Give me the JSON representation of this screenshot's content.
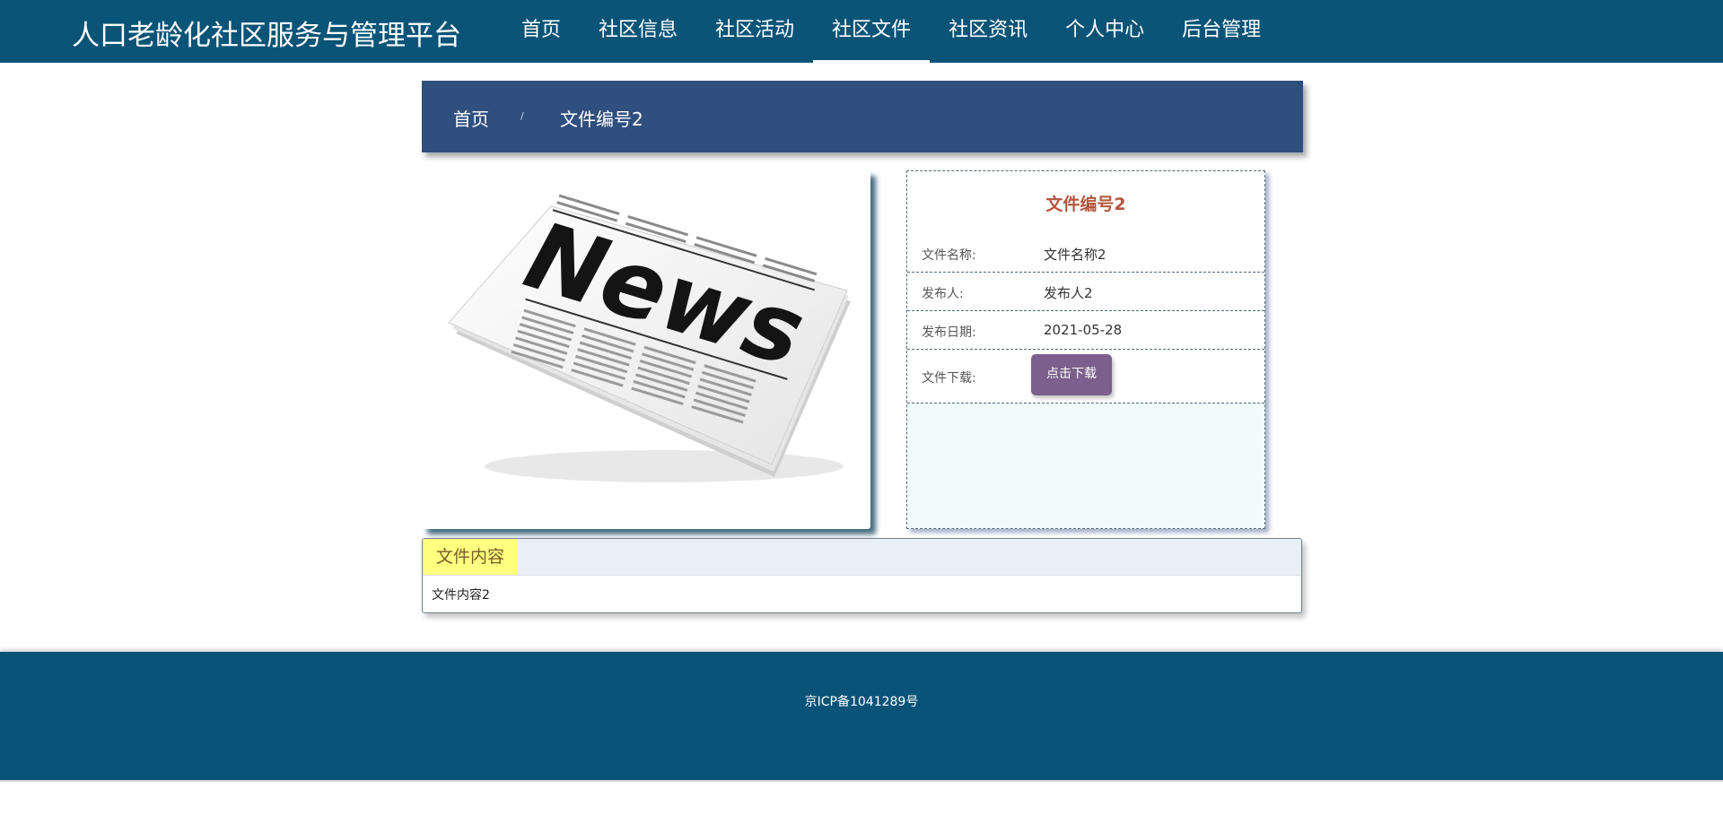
{
  "header": {
    "site_title": "人口老龄化社区服务与管理平台",
    "nav": [
      {
        "label": "首页"
      },
      {
        "label": "社区信息"
      },
      {
        "label": "社区活动"
      },
      {
        "label": "社区文件",
        "active": true
      },
      {
        "label": "社区资讯"
      },
      {
        "label": "个人中心"
      },
      {
        "label": "后台管理"
      }
    ]
  },
  "breadcrumb": {
    "home": "首页",
    "separator": "/",
    "current": "文件编号2"
  },
  "image": {
    "word": "News"
  },
  "info": {
    "title": "文件编号2",
    "rows": [
      {
        "label": "文件名称:",
        "value": "文件名称2"
      },
      {
        "label": "发布人:",
        "value": "发布人2"
      },
      {
        "label": "发布日期:",
        "value": "2021-05-28"
      }
    ],
    "download_label": "文件下载:",
    "download_button": "点击下载"
  },
  "content": {
    "tab": "文件内容",
    "body": "文件内容2"
  },
  "footer": {
    "icp": "京ICP备1041289号"
  },
  "colors": {
    "header_bg": "#0a5478",
    "breadcrumb_bg": "#2f507f",
    "info_title": "#b4553c",
    "download_button": "#7b5f8d",
    "content_tab": "#ffff80",
    "footer_bg": "#085378"
  }
}
